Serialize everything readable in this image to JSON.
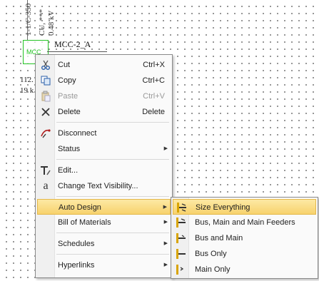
{
  "diagram": {
    "bus_labels": [
      "1-1/C-350",
      "CU, ***",
      "0.48 kV"
    ],
    "mcc_box_label": "MCC",
    "mcc_name": "MCC-2_A",
    "side_labels": [
      "112.",
      "19 k"
    ]
  },
  "context_menu": {
    "items": [
      {
        "label": "Cut",
        "shortcut": "Ctrl+X",
        "icon": "scissors-icon"
      },
      {
        "label": "Copy",
        "shortcut": "Ctrl+C",
        "icon": "copy-icon"
      },
      {
        "label": "Paste",
        "shortcut": "Ctrl+V",
        "icon": "paste-icon",
        "disabled": true
      },
      {
        "label": "Delete",
        "shortcut": "Delete",
        "icon": "delete-x-icon"
      },
      {
        "label": "Disconnect",
        "icon": "disconnect-icon"
      },
      {
        "label": "Status",
        "submenu": true
      },
      {
        "label": "Edit...",
        "icon": "edit-icon"
      },
      {
        "label": "Change Text Visibility...",
        "icon": "text-visibility-icon"
      },
      {
        "label": "Auto Design",
        "submenu": true,
        "highlighted": true
      },
      {
        "label": "Bill of Materials",
        "submenu": true
      },
      {
        "label": "Schedules",
        "submenu": true
      },
      {
        "label": "Hyperlinks",
        "submenu": true
      }
    ]
  },
  "auto_design_submenu": {
    "items": [
      {
        "label": "Size Everything",
        "highlighted": true
      },
      {
        "label": "Bus, Main and Main Feeders"
      },
      {
        "label": "Bus and Main"
      },
      {
        "label": "Bus Only"
      },
      {
        "label": "Main Only"
      }
    ]
  },
  "colors": {
    "mcc_green": "#22c322",
    "highlight": "#f7d26d"
  }
}
